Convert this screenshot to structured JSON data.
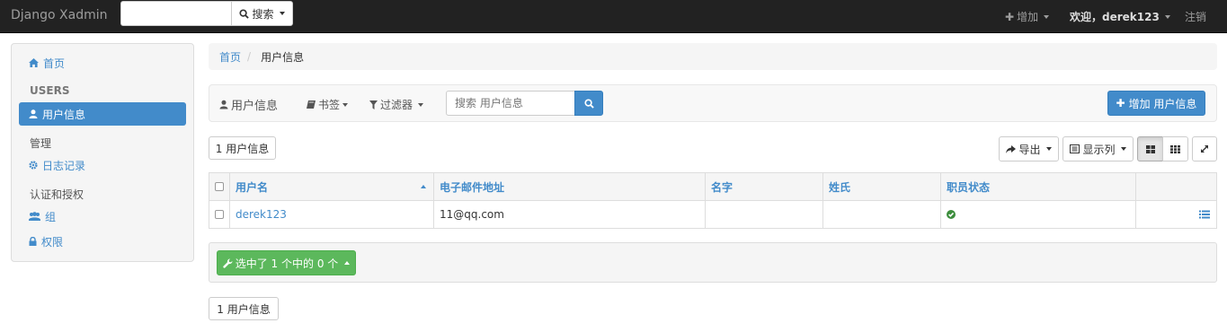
{
  "nav": {
    "brand": "Django Xadmin",
    "search_button": "搜索",
    "add_menu": "增加",
    "welcome": "欢迎，derek123",
    "logout": "注销"
  },
  "sidebar": {
    "home": "首页",
    "section_users": "USERS",
    "user_info": "用户信息",
    "section_manage": "管理",
    "log_records": "日志记录",
    "section_auth": "认证和授权",
    "groups": "组",
    "permissions": "权限"
  },
  "breadcrumb": {
    "home": "首页",
    "separator": "/",
    "current": "用户信息"
  },
  "toolbar": {
    "title": "用户信息",
    "bookmarks": "书签",
    "filters": "过滤器",
    "search_placeholder": "搜索 用户信息",
    "add_button": "增加 用户信息"
  },
  "result_count": "1 用户信息",
  "view_controls": {
    "export": "导出",
    "columns": "显示列"
  },
  "table": {
    "columns": [
      "用户名",
      "电子邮件地址",
      "名字",
      "姓氏",
      "职员状态"
    ],
    "rows": [
      {
        "username": "derek123",
        "email": "11@qq.com",
        "first_name": "",
        "last_name": "",
        "is_staff": true
      }
    ]
  },
  "actions": {
    "selected_label": "选中了 1 个中的 0 个"
  },
  "colors": {
    "primary": "#428bca",
    "success": "#5cb85c",
    "navbar": "#222222"
  }
}
